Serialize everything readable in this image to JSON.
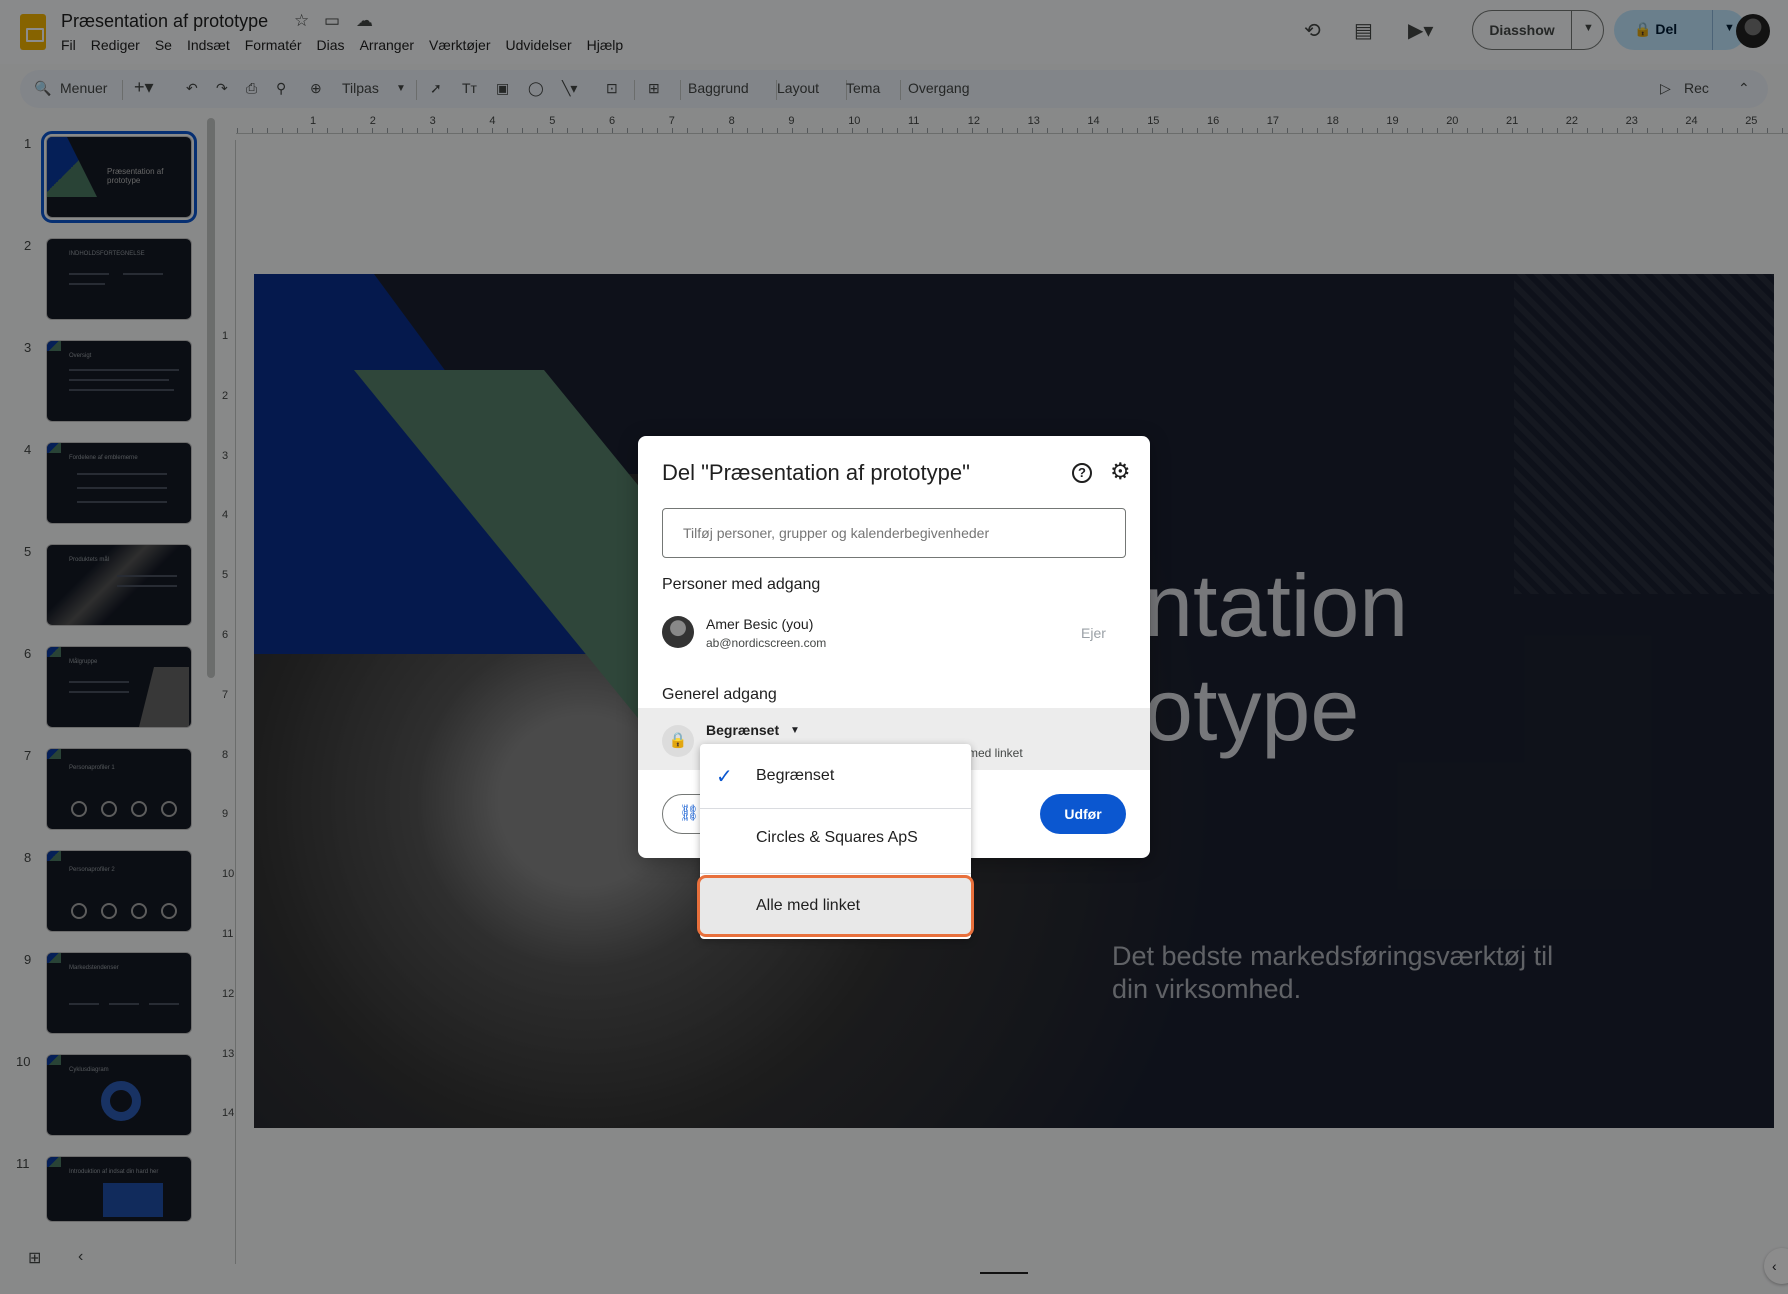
{
  "header": {
    "doc_title": "Præsentation af prototype",
    "menu": [
      "Fil",
      "Rediger",
      "Se",
      "Indsæt",
      "Formatér",
      "Dias",
      "Arranger",
      "Værktøjer",
      "Udvidelser",
      "Hjælp"
    ],
    "slideshow_label": "Diasshow",
    "share_label": "Del"
  },
  "toolbar": {
    "search_label": "Menuer",
    "zoom_label": "Tilpas",
    "background_label": "Baggrund",
    "layout_label": "Layout",
    "theme_label": "Tema",
    "transition_label": "Overgang",
    "rec_label": "Rec"
  },
  "filmstrip": {
    "slides": [
      {
        "num": "1",
        "title": "Præsentation af prototype"
      },
      {
        "num": "2",
        "title": "INDHOLDSFORTEGNELSE"
      },
      {
        "num": "3",
        "title": "Oversigt"
      },
      {
        "num": "4",
        "title": "Fordelene af emblemerne"
      },
      {
        "num": "5",
        "title": "Produktets mål"
      },
      {
        "num": "6",
        "title": "Målgruppe"
      },
      {
        "num": "7",
        "title": "Personaprofiler 1"
      },
      {
        "num": "8",
        "title": "Personaprofiler 2"
      },
      {
        "num": "9",
        "title": "Markedstendenser"
      },
      {
        "num": "10",
        "title": "Cyklusdiagram"
      },
      {
        "num": "11",
        "title": "Introduktion af indsat din hard her"
      }
    ]
  },
  "ruler": {
    "h": [
      "1",
      "2",
      "3",
      "4",
      "5",
      "6",
      "7",
      "8",
      "9",
      "10",
      "11",
      "12",
      "13",
      "14",
      "15",
      "16",
      "17",
      "18",
      "19",
      "20",
      "21",
      "22",
      "23",
      "24",
      "25"
    ],
    "v": [
      "1",
      "2",
      "3",
      "4",
      "5",
      "6",
      "7",
      "8",
      "9",
      "10",
      "11",
      "12",
      "13",
      "14"
    ]
  },
  "slide": {
    "title_line1": "ntation",
    "title_line2": "otype",
    "subtitle": "Det bedste markedsføringsværktøj til din virksomhed."
  },
  "dialog": {
    "title": "Del \"Præsentation af prototype\"",
    "add_placeholder": "Tilføj personer, grupper og kalenderbegivenheder",
    "people_heading": "Personer med adgang",
    "person_name": "Amer Besic (you)",
    "person_email": "ab@nordicscreen.com",
    "person_role": "Ejer",
    "general_heading": "Generel adgang",
    "access_value": "Begrænset",
    "access_desc": "med linket",
    "done_label": "Udfør"
  },
  "dropdown": {
    "options": [
      "Begrænset",
      "Circles & Squares ApS",
      "Alle med linket"
    ],
    "selected": "Begrænset",
    "highlighted": "Alle med linket"
  }
}
